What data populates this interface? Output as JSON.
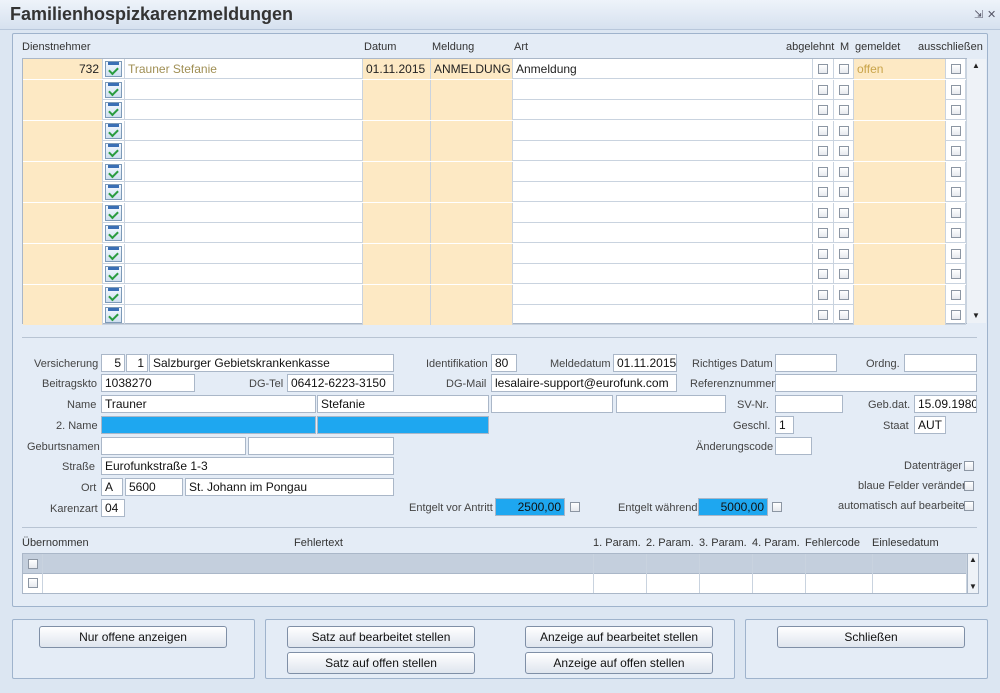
{
  "window": {
    "title": "Familienhospizkarenzmeldungen",
    "minimize_glyph": "⇲",
    "close_glyph": "✕"
  },
  "grid": {
    "headers": {
      "dienstnehmer": "Dienstnehmer",
      "datum": "Datum",
      "meldung": "Meldung",
      "art": "Art",
      "abgelehnt": "abgelehnt",
      "m": "M",
      "gemeldet": "gemeldet",
      "ausschliessen": "ausschließen"
    },
    "rows": [
      {
        "nr": "732",
        "name": "Trauner Stefanie",
        "datum": "01.11.2015",
        "meldung": "ANMELDUNG",
        "art": "Anmeldung",
        "gemeldet": "offen"
      },
      {
        "nr": "",
        "name": "",
        "datum": "",
        "meldung": "",
        "art": "",
        "gemeldet": ""
      },
      {
        "nr": "",
        "name": "",
        "datum": "",
        "meldung": "",
        "art": "",
        "gemeldet": ""
      },
      {
        "nr": "",
        "name": "",
        "datum": "",
        "meldung": "",
        "art": "",
        "gemeldet": ""
      },
      {
        "nr": "",
        "name": "",
        "datum": "",
        "meldung": "",
        "art": "",
        "gemeldet": ""
      },
      {
        "nr": "",
        "name": "",
        "datum": "",
        "meldung": "",
        "art": "",
        "gemeldet": ""
      },
      {
        "nr": "",
        "name": "",
        "datum": "",
        "meldung": "",
        "art": "",
        "gemeldet": ""
      },
      {
        "nr": "",
        "name": "",
        "datum": "",
        "meldung": "",
        "art": "",
        "gemeldet": ""
      },
      {
        "nr": "",
        "name": "",
        "datum": "",
        "meldung": "",
        "art": "",
        "gemeldet": ""
      },
      {
        "nr": "",
        "name": "",
        "datum": "",
        "meldung": "",
        "art": "",
        "gemeldet": ""
      },
      {
        "nr": "",
        "name": "",
        "datum": "",
        "meldung": "",
        "art": "",
        "gemeldet": ""
      },
      {
        "nr": "",
        "name": "",
        "datum": "",
        "meldung": "",
        "art": "",
        "gemeldet": ""
      },
      {
        "nr": "",
        "name": "",
        "datum": "",
        "meldung": "",
        "art": "",
        "gemeldet": ""
      }
    ]
  },
  "detail": {
    "labels": {
      "versicherung": "Versicherung",
      "identifikation": "Identifikation",
      "meldedatum": "Meldedatum",
      "richtiges_datum": "Richtiges Datum",
      "ordng": "Ordng.",
      "beitragskto": "Beitragskto",
      "dg_tel": "DG-Tel",
      "dg_mail": "DG-Mail",
      "referenznummer": "Referenznummer",
      "name": "Name",
      "sv_nr": "SV-Nr.",
      "geb_dat": "Geb.dat.",
      "name2": "2. Name",
      "geschl": "Geschl.",
      "staat": "Staat",
      "geburtsnamen": "Geburtsnamen",
      "aenderungscode": "Änderungscode",
      "strasse": "Straße",
      "datentraeger": "Datenträger",
      "ort": "Ort",
      "blaue_felder": "blaue Felder verändert",
      "karenzart": "Karenzart",
      "entgelt_vor": "Entgelt vor Antritt",
      "entgelt_waehrend": "Entgelt während",
      "auto_bearbeitet": "automatisch auf bearbeitet"
    },
    "values": {
      "vers1": "5",
      "vers2": "1",
      "versicherung_name": "Salzburger Gebietskrankenkasse",
      "identifikation": "80",
      "meldedatum": "01.11.2015",
      "richtiges_datum": "",
      "ordng": "",
      "beitragskto": "1038270",
      "dg_tel": "06412-6223-3150",
      "dg_mail": "lesalaire-support@eurofunk.com",
      "referenznummer": "",
      "nachname": "Trauner",
      "vorname": "Stefanie",
      "name_extra1": "",
      "name_extra2": "",
      "sv_nr": "",
      "geb_dat": "15.09.1980",
      "name2_a": "",
      "name2_b": "",
      "geschl": "1",
      "staat": "AUT",
      "geburtsname1": "",
      "geburtsname2": "",
      "aenderungscode": "",
      "strasse": "Eurofunkstraße 1-3",
      "land": "A",
      "plz": "5600",
      "ort": "St. Johann im Pongau",
      "karenzart": "04",
      "entgelt_vor": "2500,00",
      "entgelt_waehrend": "5000,00"
    }
  },
  "error_grid": {
    "headers": {
      "uebernommen": "Übernommen",
      "fehlertext": "Fehlertext",
      "p1": "1. Param.",
      "p2": "2. Param.",
      "p3": "3. Param.",
      "p4": "4. Param.",
      "fehlercode": "Fehlercode",
      "einlesedatum": "Einlesedatum"
    }
  },
  "buttons": {
    "nur_offene": "Nur offene anzeigen",
    "satz_bearbeitet": "Satz auf bearbeitet stellen",
    "satz_offen": "Satz auf offen stellen",
    "anzeige_bearbeitet": "Anzeige auf bearbeitet stellen",
    "anzeige_offen": "Anzeige auf offen stellen",
    "schliessen": "Schließen"
  },
  "colors": {
    "accent_blue": "#1ea7f0",
    "row_tan": "#fde9c4",
    "status_text": "#a8882a"
  }
}
